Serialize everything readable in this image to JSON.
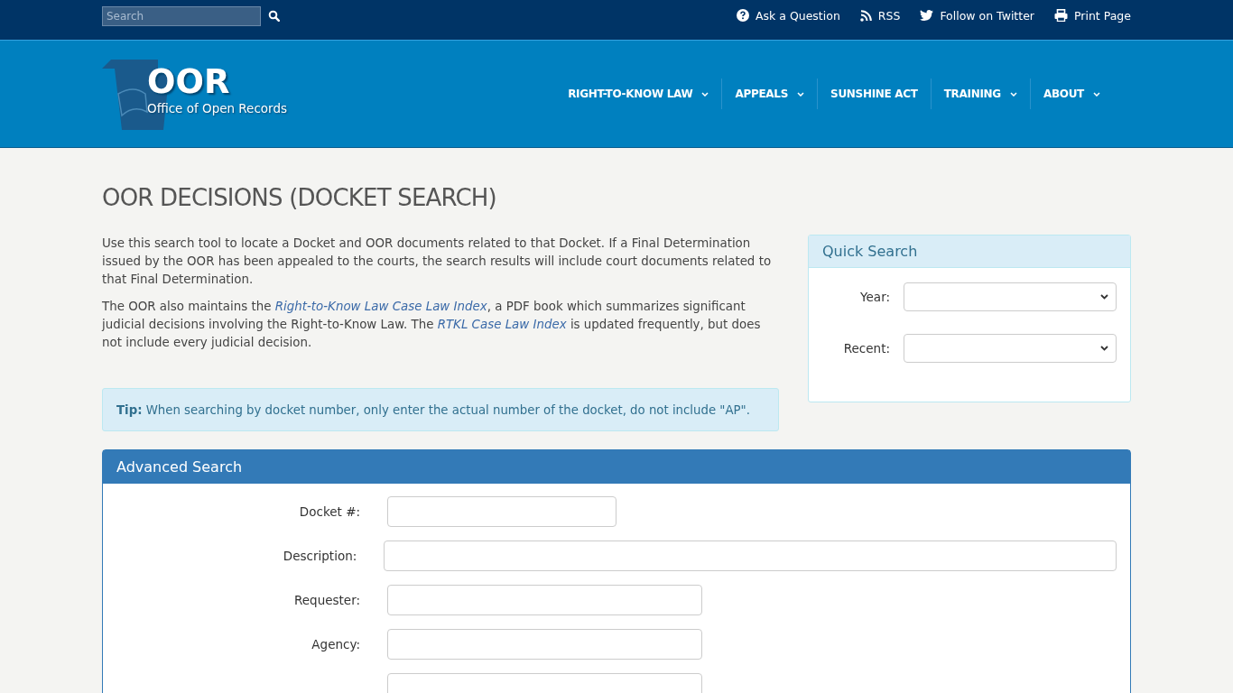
{
  "topbar": {
    "search": {
      "placeholder": "Search"
    },
    "links": [
      {
        "kind": "question",
        "label": "Ask a Question"
      },
      {
        "kind": "rss",
        "label": "RSS"
      },
      {
        "kind": "twitter",
        "label": "Follow on Twitter"
      },
      {
        "kind": "print",
        "label": "Print Page"
      }
    ]
  },
  "logo": {
    "title": "OOR",
    "subtitle": "Office of Open Records"
  },
  "nav": [
    {
      "label": "RIGHT-TO-KNOW LAW",
      "dropdown": true
    },
    {
      "label": "APPEALS",
      "dropdown": true
    },
    {
      "label": "SUNSHINE ACT",
      "dropdown": false
    },
    {
      "label": "TRAINING",
      "dropdown": true
    },
    {
      "label": "ABOUT",
      "dropdown": true
    }
  ],
  "page_title": "OOR DECISIONS (DOCKET SEARCH)",
  "paragraphs": [
    [
      {
        "text": "Use this search tool to locate a Docket and OOR documents related to that Docket. If a Final Determination issued by the OOR has been appealed to the courts, the search results will include court documents related to that Final Determination.",
        "link": false
      }
    ],
    [
      {
        "text": "The OOR also maintains the ",
        "link": false
      },
      {
        "text": "Right-to-Know Law Case Law Index",
        "link": true
      },
      {
        "text": ", a PDF book which summarizes significant judicial decisions involving the Right-to-Know Law. The ",
        "link": false
      },
      {
        "text": "RTKL Case Law Index",
        "link": true
      },
      {
        "text": " is updated frequently, but does not include every judicial decision.",
        "link": false
      }
    ]
  ],
  "tip": {
    "label": "Tip:",
    "text": "When searching by docket number, only enter the actual number of the docket, do not include \"AP\"."
  },
  "quick_search": {
    "title": "Quick Search",
    "fields": [
      {
        "label": "Year:"
      },
      {
        "label": "Recent:"
      }
    ]
  },
  "advanced_search": {
    "title": "Advanced Search",
    "fields": [
      {
        "label": "Docket #:",
        "kind": "short"
      },
      {
        "label": "Description:",
        "kind": "long"
      },
      {
        "label": "Requester:",
        "kind": "medium"
      },
      {
        "label": "Agency:",
        "kind": "medium"
      },
      {
        "kind": "medium"
      }
    ]
  }
}
